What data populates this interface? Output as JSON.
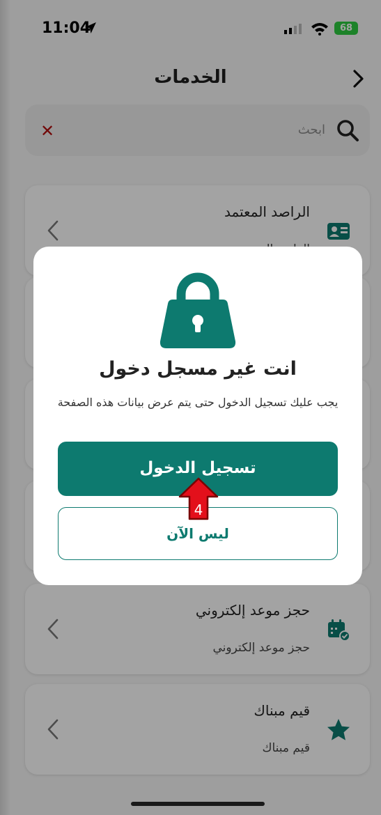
{
  "status_bar": {
    "time": "11:04",
    "battery": "68"
  },
  "header": {
    "title": "الخدمات"
  },
  "search": {
    "placeholder": "ابحث"
  },
  "services": [
    {
      "title": "الراصد المعتمد",
      "subtitle": "الراصد المعتمد",
      "icon": "id-card-icon"
    },
    {
      "title": "حجز موعد إلكتروني",
      "subtitle": "حجز موعد إلكتروني",
      "icon": "calendar-check-icon"
    },
    {
      "title": "قيم مبناك",
      "subtitle": "قيم مبناك",
      "icon": "star-icon"
    }
  ],
  "modal": {
    "title": "انت غير مسجل دخول",
    "description": "يجب عليك تسجيل الدخول حتى يتم عرض بيانات هذه الصفحة",
    "login_button": "تسجيل الدخول",
    "later_button": "ليس الآن"
  },
  "annotation": {
    "step_number": "4"
  },
  "colors": {
    "accent": "#0d7a6f",
    "danger": "#b20f0f",
    "annotation": "#e3101b"
  }
}
